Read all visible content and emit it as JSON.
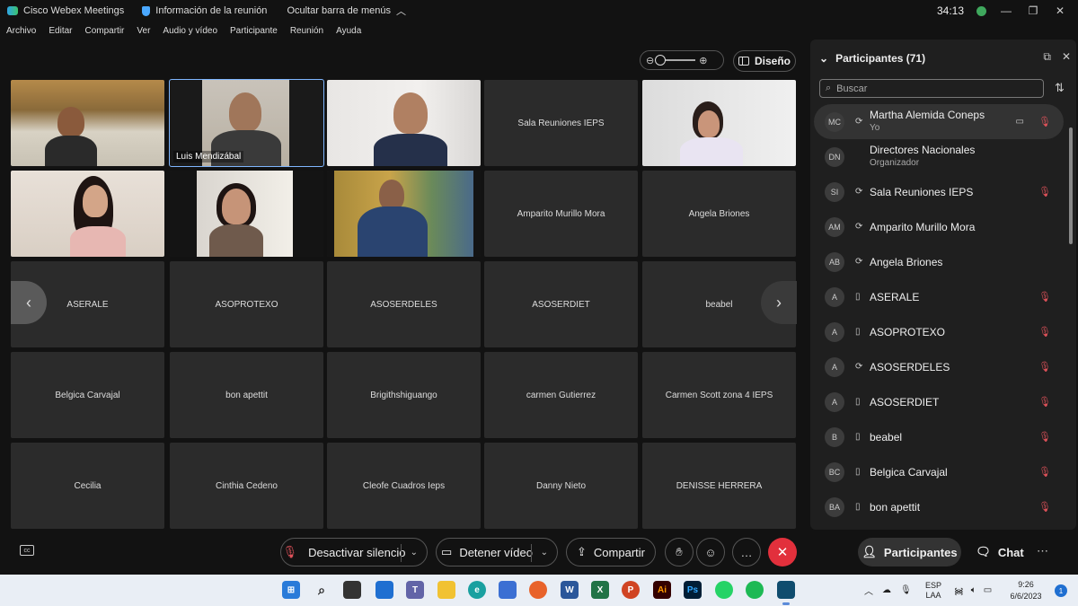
{
  "titlebar": {
    "app_name": "Cisco Webex Meetings",
    "meeting_info": "Información de la reunión",
    "hide_menu": "Ocultar barra de menús",
    "timer": "34:13"
  },
  "menu": [
    "Archivo",
    "Editar",
    "Compartir",
    "Ver",
    "Audio y vídeo",
    "Participante",
    "Reunión",
    "Ayuda"
  ],
  "layout_button": "Diseño",
  "grid": {
    "active_name_tag": "Luis Mendizábal",
    "tiles": [
      "",
      "",
      "",
      "Sala Reuniones IEPS",
      "",
      "",
      "",
      "",
      "Amparito Murillo Mora",
      "Angela Briones",
      "ASERALE",
      "ASOPROTEXO",
      "ASOSERDELES",
      "ASOSERDIET",
      "beabel",
      "Belgica Carvajal",
      "bon apettit",
      "Brigithshiguango",
      "carmen Gutierrez",
      "Carmen Scott zona 4 IEPS",
      "Cecilia",
      "Cinthia Cedeno",
      "Cleofe Cuadros Ieps",
      "Danny Nieto",
      "DENISSE HERRERA"
    ]
  },
  "panel": {
    "title": "Participantes (71)",
    "search_placeholder": "Buscar",
    "participants": [
      {
        "initials": "MC",
        "name": "Martha Alemida Coneps",
        "role": "Yo",
        "device": "sync",
        "muted": true,
        "camera": true
      },
      {
        "initials": "DN",
        "name": "Directores Nacionales",
        "role": "Organizador",
        "device": "",
        "muted": false,
        "camera": false
      },
      {
        "initials": "SI",
        "name": "Sala Reuniones IEPS",
        "role": "",
        "device": "sync",
        "muted": true,
        "camera": false
      },
      {
        "initials": "AM",
        "name": "Amparito Murillo Mora",
        "role": "",
        "device": "sync",
        "muted": false,
        "camera": false
      },
      {
        "initials": "AB",
        "name": "Angela Briones",
        "role": "",
        "device": "sync",
        "muted": false,
        "camera": false
      },
      {
        "initials": "A",
        "name": "ASERALE",
        "role": "",
        "device": "phone",
        "muted": true,
        "camera": false
      },
      {
        "initials": "A",
        "name": "ASOPROTEXO",
        "role": "",
        "device": "phone",
        "muted": true,
        "camera": false
      },
      {
        "initials": "A",
        "name": "ASOSERDELES",
        "role": "",
        "device": "sync",
        "muted": true,
        "camera": false
      },
      {
        "initials": "A",
        "name": "ASOSERDIET",
        "role": "",
        "device": "phone",
        "muted": true,
        "camera": false
      },
      {
        "initials": "B",
        "name": "beabel",
        "role": "",
        "device": "phone",
        "muted": true,
        "camera": false
      },
      {
        "initials": "BC",
        "name": "Belgica Carvajal",
        "role": "",
        "device": "phone",
        "muted": true,
        "camera": false
      },
      {
        "initials": "BA",
        "name": "bon apettit",
        "role": "",
        "device": "phone",
        "muted": true,
        "camera": false
      }
    ]
  },
  "controls": {
    "unmute": "Desactivar silencio",
    "stop_video": "Detener vídeo",
    "share": "Compartir",
    "participants_tab": "Participantes",
    "chat_tab": "Chat"
  },
  "taskbar": {
    "lang_top": "ESP",
    "lang_bottom": "LAA",
    "time": "9:26",
    "date": "6/6/2023",
    "notifications": "1"
  },
  "colors": {
    "accent_red": "#e2303c",
    "mute_red": "#e0525a",
    "active_tile_border": "#7fb6ff"
  }
}
